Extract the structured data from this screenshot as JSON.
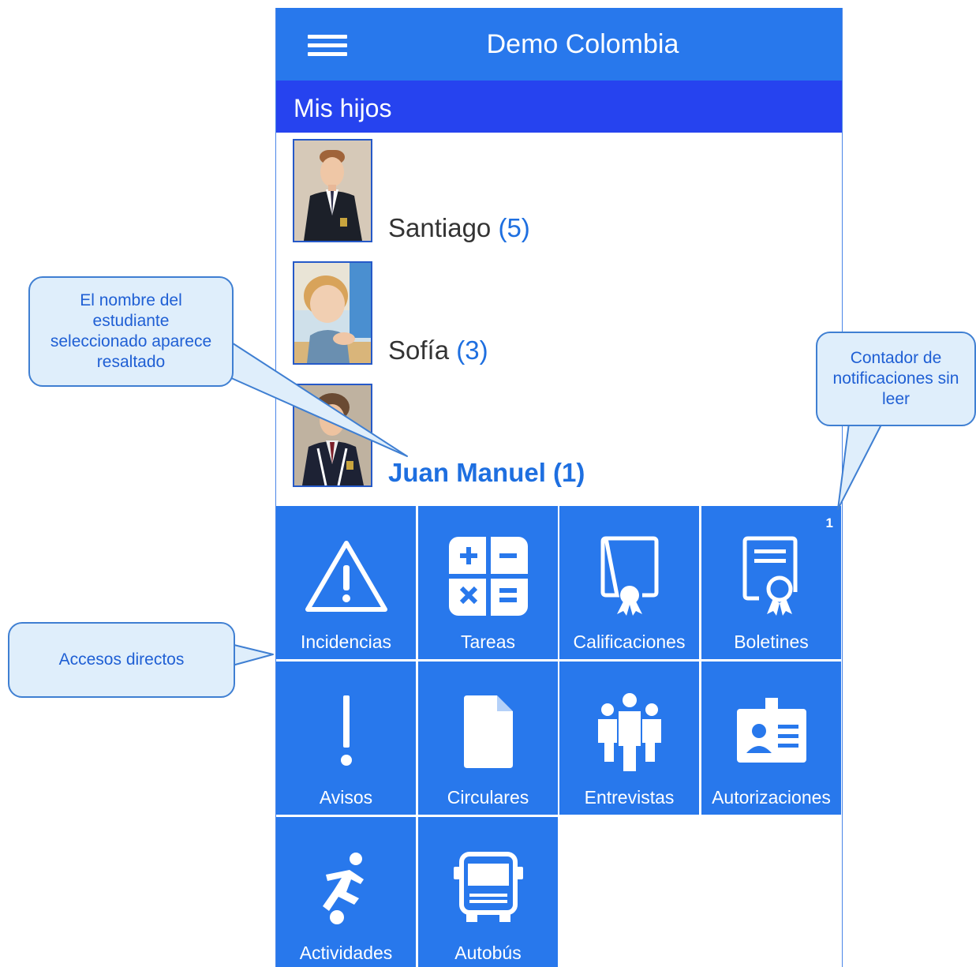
{
  "header": {
    "title": "Demo Colombia",
    "menu_icon": "hamburger-menu-icon",
    "color": "#2878ec"
  },
  "section": {
    "title": "Mis hijos",
    "color": "#2643ef"
  },
  "children": [
    {
      "name": "Santiago",
      "count": "(5)",
      "selected": false
    },
    {
      "name": "Sofía",
      "count": "(3)",
      "selected": false
    },
    {
      "name": "Juan Manuel (1)",
      "count": "",
      "selected": true
    }
  ],
  "tiles": [
    {
      "label": "Incidencias",
      "icon": "warning-triangle-icon",
      "badge": ""
    },
    {
      "label": "Tareas",
      "icon": "calculator-icon",
      "badge": ""
    },
    {
      "label": "Calificaciones",
      "icon": "certificate-icon",
      "badge": ""
    },
    {
      "label": "Boletines",
      "icon": "report-card-icon",
      "badge": "1"
    },
    {
      "label": "Avisos",
      "icon": "exclamation-icon",
      "badge": ""
    },
    {
      "label": "Circulares",
      "icon": "document-icon",
      "badge": ""
    },
    {
      "label": "Entrevistas",
      "icon": "people-icon",
      "badge": ""
    },
    {
      "label": "Autorizaciones",
      "icon": "id-badge-icon",
      "badge": ""
    },
    {
      "label": "Actividades",
      "icon": "soccer-player-icon",
      "badge": ""
    },
    {
      "label": "Autobús",
      "icon": "bus-icon",
      "badge": ""
    }
  ],
  "callouts": {
    "selected_student": "El nombre del estudiante seleccionado aparece resaltado",
    "shortcuts": "Accesos directos",
    "counter": "Contador de notificaciones sin leer"
  },
  "colors": {
    "tile": "#2878ec",
    "selected_text": "#1e6fe0",
    "callout_fill": "#dfeefb",
    "callout_border": "#3f7fd2"
  }
}
